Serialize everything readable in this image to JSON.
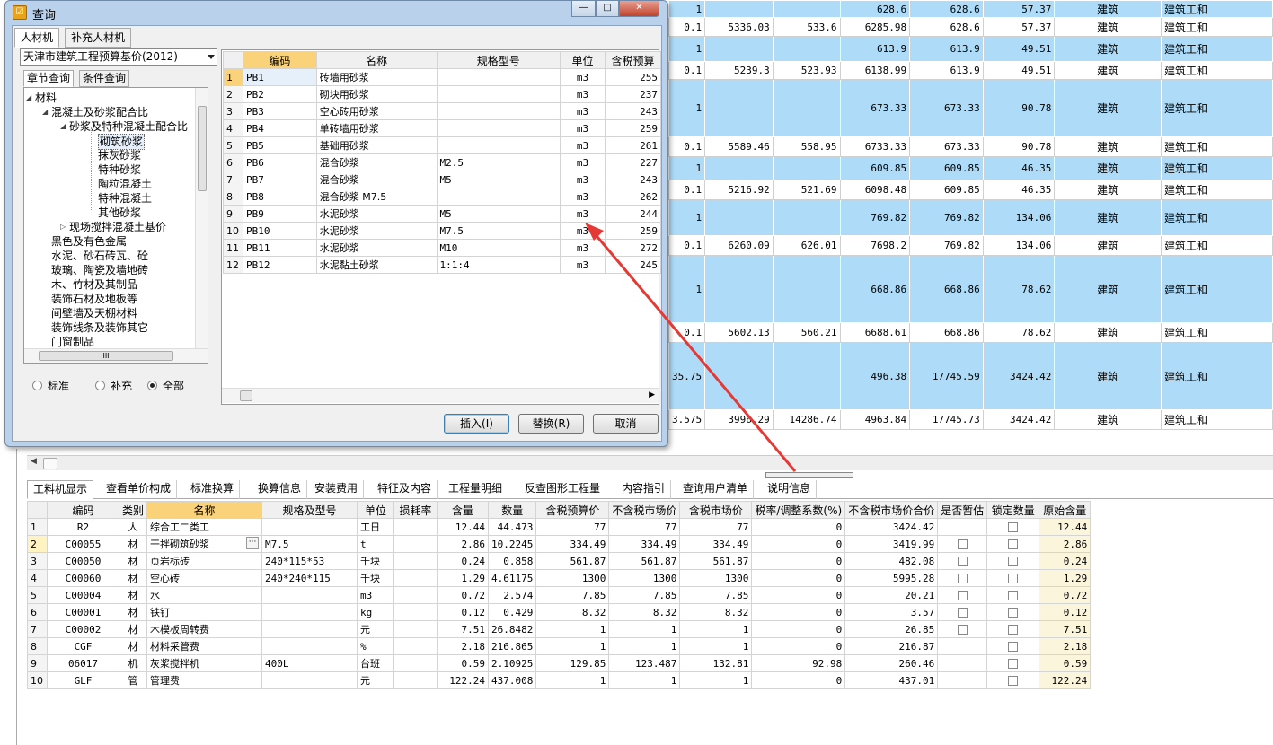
{
  "background_table": {
    "rows": [
      {
        "type": "blue",
        "c1": "1",
        "c2": "",
        "c3": "",
        "c4": "628.6",
        "c5": "628.6",
        "c6": "57.37",
        "cat": "建筑",
        "cat2": "建筑工和",
        "h": 19
      },
      {
        "type": "white",
        "c1": "0.1",
        "c2": "5336.03",
        "c3": "533.6",
        "c4": "6285.98",
        "c5": "628.6",
        "c6": "57.37",
        "cat": "建筑",
        "cat2": "建筑工和",
        "h": 21
      },
      {
        "type": "blue",
        "c1": "1",
        "c2": "",
        "c3": "",
        "c4": "613.9",
        "c5": "613.9",
        "c6": "49.51",
        "cat": "建筑",
        "cat2": "建筑工和",
        "h": 28
      },
      {
        "type": "white",
        "c1": "0.1",
        "c2": "5239.3",
        "c3": "523.93",
        "c4": "6138.99",
        "c5": "613.9",
        "c6": "49.51",
        "cat": "建筑",
        "cat2": "建筑工和",
        "h": 20
      },
      {
        "type": "blue",
        "c1": "1",
        "c2": "",
        "c3": "",
        "c4": "673.33",
        "c5": "673.33",
        "c6": "90.78",
        "cat": "建筑",
        "cat2": "建筑工和",
        "h": 64
      },
      {
        "type": "white",
        "c1": "0.1",
        "c2": "5589.46",
        "c3": "558.95",
        "c4": "6733.33",
        "c5": "673.33",
        "c6": "90.78",
        "cat": "建筑",
        "cat2": "建筑工和",
        "h": 22
      },
      {
        "type": "blue",
        "c1": "1",
        "c2": "",
        "c3": "",
        "c4": "609.85",
        "c5": "609.85",
        "c6": "46.35",
        "cat": "建筑",
        "cat2": "建筑工和",
        "h": 26
      },
      {
        "type": "white",
        "c1": "0.1",
        "c2": "5216.92",
        "c3": "521.69",
        "c4": "6098.48",
        "c5": "609.85",
        "c6": "46.35",
        "cat": "建筑",
        "cat2": "建筑工和",
        "h": 22
      },
      {
        "type": "blue",
        "c1": "1",
        "c2": "",
        "c3": "",
        "c4": "769.82",
        "c5": "769.82",
        "c6": "134.06",
        "cat": "建筑",
        "cat2": "建筑工和",
        "h": 40
      },
      {
        "type": "white",
        "c1": "0.1",
        "c2": "6260.09",
        "c3": "626.01",
        "c4": "7698.2",
        "c5": "769.82",
        "c6": "134.06",
        "cat": "建筑",
        "cat2": "建筑工和",
        "h": 22
      },
      {
        "type": "blue",
        "c1": "1",
        "c2": "",
        "c3": "",
        "c4": "668.86",
        "c5": "668.86",
        "c6": "78.62",
        "cat": "建筑",
        "cat2": "建筑工和",
        "h": 75
      },
      {
        "type": "white",
        "c1": "0.1",
        "c2": "5602.13",
        "c3": "560.21",
        "c4": "6688.61",
        "c5": "668.86",
        "c6": "78.62",
        "cat": "建筑",
        "cat2": "建筑工和",
        "h": 22
      },
      {
        "type": "blue",
        "c1": "35.75",
        "c2": "",
        "c3": "",
        "c4": "496.38",
        "c5": "17745.59",
        "c6": "3424.42",
        "cat": "建筑",
        "cat2": "建筑工和",
        "h": 75
      },
      {
        "type": "white",
        "c1": "3.575",
        "c2": "3996.29",
        "c3": "14286.74",
        "c4": "4963.84",
        "c5": "17745.73",
        "c6": "3424.42",
        "cat": "建筑",
        "cat2": "建筑工和",
        "h": 22
      }
    ]
  },
  "bottom_tabs": [
    "工料机显示",
    "查看单价构成",
    "标准换算",
    "换算信息",
    "安装费用",
    "特征及内容",
    "工程量明细",
    "反查图形工程量",
    "内容指引",
    "查询用户清单",
    "说明信息"
  ],
  "grid": {
    "headers": [
      "",
      "编码",
      "类别",
      "名称",
      "规格及型号",
      "单位",
      "损耗率",
      "含量",
      "数量",
      "含税预算价",
      "不含税市场价",
      "含税市场价",
      "税率/调整系数(%)",
      "不含税市场价合价",
      "是否暂估",
      "锁定数量",
      "原始含量"
    ],
    "rows": [
      {
        "n": "1",
        "code": "R2",
        "cat": "人",
        "name": "综合工二类工",
        "spec": "",
        "unit": "工日",
        "loss": "",
        "qty": "12.44",
        "amount": "44.473",
        "tax_budget": "77",
        "notax_market": "77",
        "tax_market": "77",
        "rate": "0",
        "notax_total": "3424.42",
        "est": false,
        "lock": true,
        "orig": "12.44"
      },
      {
        "n": "2",
        "code": "C00055",
        "cat": "材",
        "name": "干拌砌筑砂浆",
        "spec": "M7.5",
        "unit": "t",
        "loss": "",
        "qty": "2.86",
        "amount": "10.2245",
        "tax_budget": "334.49",
        "notax_market": "334.49",
        "tax_market": "334.49",
        "rate": "0",
        "notax_total": "3419.99",
        "est": true,
        "lock": true,
        "orig": "2.86"
      },
      {
        "n": "3",
        "code": "C00050",
        "cat": "材",
        "name": "页岩标砖",
        "spec": "240*115*53",
        "unit": "千块",
        "loss": "",
        "qty": "0.24",
        "amount": "0.858",
        "tax_budget": "561.87",
        "notax_market": "561.87",
        "tax_market": "561.87",
        "rate": "0",
        "notax_total": "482.08",
        "est": true,
        "lock": true,
        "orig": "0.24"
      },
      {
        "n": "4",
        "code": "C00060",
        "cat": "材",
        "name": "空心砖",
        "spec": "240*240*115",
        "unit": "千块",
        "loss": "",
        "qty": "1.29",
        "amount": "4.61175",
        "tax_budget": "1300",
        "notax_market": "1300",
        "tax_market": "1300",
        "rate": "0",
        "notax_total": "5995.28",
        "est": true,
        "lock": true,
        "orig": "1.29"
      },
      {
        "n": "5",
        "code": "C00004",
        "cat": "材",
        "name": "水",
        "spec": "",
        "unit": "m3",
        "loss": "",
        "qty": "0.72",
        "amount": "2.574",
        "tax_budget": "7.85",
        "notax_market": "7.85",
        "tax_market": "7.85",
        "rate": "0",
        "notax_total": "20.21",
        "est": true,
        "lock": true,
        "orig": "0.72"
      },
      {
        "n": "6",
        "code": "C00001",
        "cat": "材",
        "name": "铁钉",
        "spec": "",
        "unit": "kg",
        "loss": "",
        "qty": "0.12",
        "amount": "0.429",
        "tax_budget": "8.32",
        "notax_market": "8.32",
        "tax_market": "8.32",
        "rate": "0",
        "notax_total": "3.57",
        "est": true,
        "lock": true,
        "orig": "0.12"
      },
      {
        "n": "7",
        "code": "C00002",
        "cat": "材",
        "name": "木模板周转费",
        "spec": "",
        "unit": "元",
        "loss": "",
        "qty": "7.51",
        "amount": "26.8482",
        "tax_budget": "1",
        "notax_market": "1",
        "tax_market": "1",
        "rate": "0",
        "notax_total": "26.85",
        "est": true,
        "lock": true,
        "orig": "7.51"
      },
      {
        "n": "8",
        "code": "CGF",
        "cat": "材",
        "name": "材料采管费",
        "spec": "",
        "unit": "%",
        "loss": "",
        "qty": "2.18",
        "amount": "216.865",
        "tax_budget": "1",
        "notax_market": "1",
        "tax_market": "1",
        "rate": "0",
        "notax_total": "216.87",
        "est": false,
        "lock": true,
        "orig": "2.18"
      },
      {
        "n": "9",
        "code": "06017",
        "cat": "机",
        "name": "灰浆搅拌机",
        "spec": "400L",
        "unit": "台班",
        "loss": "",
        "qty": "0.59",
        "amount": "2.10925",
        "tax_budget": "129.85",
        "notax_market": "123.487",
        "tax_market": "132.81",
        "rate": "92.98",
        "notax_total": "260.46",
        "est": false,
        "lock": true,
        "orig": "0.59"
      },
      {
        "n": "10",
        "code": "GLF",
        "cat": "管",
        "name": "管理费",
        "spec": "",
        "unit": "元",
        "loss": "",
        "qty": "122.24",
        "amount": "437.008",
        "tax_budget": "1",
        "notax_market": "1",
        "tax_market": "1",
        "rate": "0",
        "notax_total": "437.01",
        "est": false,
        "lock": true,
        "orig": "122.24"
      }
    ]
  },
  "dialog": {
    "title": "查询",
    "tabs": [
      "人材机",
      "补充人材机"
    ],
    "library": "天津市建筑工程预算基价(2012)",
    "subtabs": [
      "章节查询",
      "条件查询"
    ],
    "tree": [
      {
        "label": "材料",
        "level": 0,
        "exp": "◢"
      },
      {
        "label": "混凝土及砂浆配合比",
        "level": 1,
        "exp": "◢"
      },
      {
        "label": "砂浆及特种混凝土配合比",
        "level": 2,
        "exp": "◢"
      },
      {
        "label": "砌筑砂浆",
        "level": 3,
        "exp": "",
        "sel": true
      },
      {
        "label": "抹灰砂浆",
        "level": 3,
        "exp": ""
      },
      {
        "label": "特种砂浆",
        "level": 3,
        "exp": ""
      },
      {
        "label": "陶粒混凝土",
        "level": 3,
        "exp": ""
      },
      {
        "label": "特种混凝土",
        "level": 3,
        "exp": ""
      },
      {
        "label": "其他砂浆",
        "level": 3,
        "exp": ""
      },
      {
        "label": "现场搅拌混凝土基价",
        "level": 2,
        "exp": "▷"
      },
      {
        "label": "黑色及有色金属",
        "level": 1,
        "exp": ""
      },
      {
        "label": "水泥、砂石砖瓦、砼",
        "level": 1,
        "exp": ""
      },
      {
        "label": "玻璃、陶瓷及墙地砖",
        "level": 1,
        "exp": ""
      },
      {
        "label": "木、竹材及其制品",
        "level": 1,
        "exp": ""
      },
      {
        "label": "装饰石材及地板等",
        "level": 1,
        "exp": ""
      },
      {
        "label": "间壁墙及天棚材料",
        "level": 1,
        "exp": ""
      },
      {
        "label": "装饰线条及装饰其它",
        "level": 1,
        "exp": ""
      },
      {
        "label": "门窗制品",
        "level": 1,
        "exp": ""
      }
    ],
    "scroll_label": "III",
    "radios": [
      {
        "label": "标准",
        "on": false
      },
      {
        "label": "补充",
        "on": false
      },
      {
        "label": "全部",
        "on": true
      }
    ],
    "table": {
      "headers": [
        "",
        "编码",
        "名称",
        "规格型号",
        "单位",
        "含税预算"
      ],
      "rows": [
        {
          "n": "1",
          "code": "PB1",
          "name": "砖墙用砂浆",
          "spec": "",
          "unit": "m3",
          "price": "255"
        },
        {
          "n": "2",
          "code": "PB2",
          "name": "砌块用砂浆",
          "spec": "",
          "unit": "m3",
          "price": "237"
        },
        {
          "n": "3",
          "code": "PB3",
          "name": "空心砖用砂浆",
          "spec": "",
          "unit": "m3",
          "price": "243"
        },
        {
          "n": "4",
          "code": "PB4",
          "name": "单砖墙用砂浆",
          "spec": "",
          "unit": "m3",
          "price": "259"
        },
        {
          "n": "5",
          "code": "PB5",
          "name": "基础用砂浆",
          "spec": "",
          "unit": "m3",
          "price": "261"
        },
        {
          "n": "6",
          "code": "PB6",
          "name": "混合砂浆",
          "spec": "M2.5",
          "unit": "m3",
          "price": "227"
        },
        {
          "n": "7",
          "code": "PB7",
          "name": "混合砂浆",
          "spec": "M5",
          "unit": "m3",
          "price": "243"
        },
        {
          "n": "8",
          "code": "PB8",
          "name": "混合砂浆 M7.5",
          "spec": "",
          "unit": "m3",
          "price": "262"
        },
        {
          "n": "9",
          "code": "PB9",
          "name": "水泥砂浆",
          "spec": "M5",
          "unit": "m3",
          "price": "244"
        },
        {
          "n": "10",
          "code": "PB10",
          "name": "水泥砂浆",
          "spec": "M7.5",
          "unit": "m3",
          "price": "259"
        },
        {
          "n": "11",
          "code": "PB11",
          "name": "水泥砂浆",
          "spec": "M10",
          "unit": "m3",
          "price": "272"
        },
        {
          "n": "12",
          "code": "PB12",
          "name": "水泥黏土砂浆",
          "spec": "1:1:4",
          "unit": "m3",
          "price": "245"
        }
      ]
    },
    "buttons": {
      "insert": "插入(I)",
      "replace": "替换(R)",
      "cancel": "取消"
    },
    "window_controls": {
      "minimize": "—",
      "maximize": "□",
      "close": "✕"
    }
  },
  "colors": {
    "row_blue": "#aedcf8",
    "header_highlight": "#f9d27a",
    "arrow": "#e53935",
    "dialog_frame": "#b9d1ea"
  },
  "icons": {
    "app_icon": "query-app-icon",
    "arrow": "red-annotation-arrow"
  }
}
